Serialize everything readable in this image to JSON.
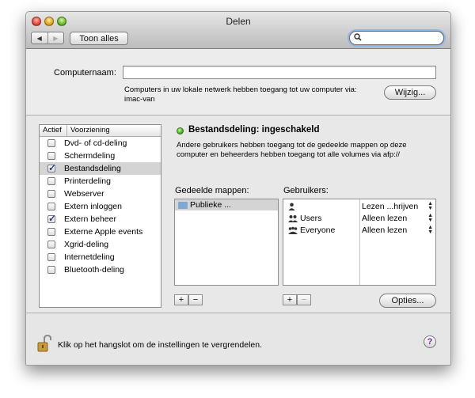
{
  "window": {
    "title": "Delen"
  },
  "toolbar": {
    "show_all_label": "Toon alles",
    "back_icon": "◀",
    "forward_icon": "▶"
  },
  "computer": {
    "name_label": "Computernaam:",
    "name_value": "",
    "access_info_line1": "Computers in uw lokale netwerk hebben toegang tot uw computer via:",
    "access_info_line2": "imac-van",
    "edit_label": "Wijzig..."
  },
  "services": {
    "col_on": "Actief",
    "col_service": "Voorziening",
    "items": [
      {
        "label": "Dvd- of cd-deling",
        "checked": false
      },
      {
        "label": "Schermdeling",
        "checked": false
      },
      {
        "label": "Bestandsdeling",
        "checked": true,
        "selected": true
      },
      {
        "label": "Printerdeling",
        "checked": false
      },
      {
        "label": "Webserver",
        "checked": false
      },
      {
        "label": "Extern inloggen",
        "checked": false
      },
      {
        "label": "Extern beheer",
        "checked": true
      },
      {
        "label": "Externe Apple events",
        "checked": false
      },
      {
        "label": "Xgrid-deling",
        "checked": false
      },
      {
        "label": "Internetdeling",
        "checked": false
      },
      {
        "label": "Bluetooth-deling",
        "checked": false
      }
    ]
  },
  "detail": {
    "status_text": "Bestandsdeling: ingeschakeld",
    "status_color": "#3fb31a",
    "desc_line1": "Andere gebruikers hebben toegang tot de gedeelde mappen op deze",
    "desc_line2": "computer en beheerders hebben toegang tot alle volumes via afp://",
    "shared_folders_label": "Gedeelde mappen:",
    "users_label": "Gebruikers:",
    "folders": [
      "Publieke ..."
    ],
    "users": [
      {
        "name": "",
        "permission": "Lezen ...hrijven"
      },
      {
        "name": "Users",
        "permission": "Alleen lezen"
      },
      {
        "name": "Everyone",
        "permission": "Alleen lezen"
      }
    ],
    "add_symbol": "+",
    "remove_symbol": "−",
    "options_label": "Opties..."
  },
  "footer": {
    "lock_text": "Klik op het hangslot om de instellingen te vergrendelen.",
    "help_symbol": "?"
  }
}
